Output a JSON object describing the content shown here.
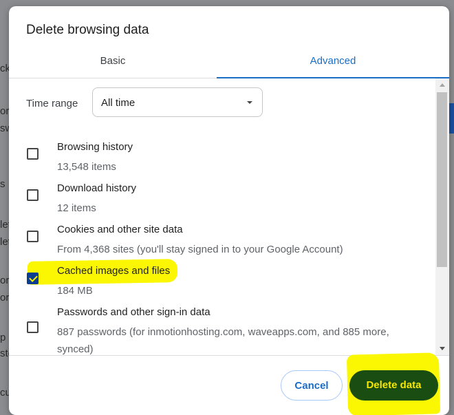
{
  "background": {
    "fragments": [
      "ck",
      "or",
      "sw",
      "s",
      "let",
      "let",
      "ord",
      "ord",
      "p",
      "sto",
      "cu"
    ]
  },
  "dialog": {
    "title": "Delete browsing data",
    "tabs": [
      {
        "label": "Basic",
        "active": false
      },
      {
        "label": "Advanced",
        "active": true
      }
    ],
    "time_range": {
      "label": "Time range",
      "value": "All time"
    },
    "items": [
      {
        "title": "Browsing history",
        "subtitle": "13,548 items",
        "checked": false
      },
      {
        "title": "Download history",
        "subtitle": "12 items",
        "checked": false
      },
      {
        "title": "Cookies and other site data",
        "subtitle": "From 4,368 sites (you'll stay signed in to your Google Account)",
        "checked": false
      },
      {
        "title": "Cached images and files",
        "subtitle": "184 MB",
        "checked": true
      },
      {
        "title": "Passwords and other sign-in data",
        "subtitle": "887 passwords (for inmotionhosting.com, waveapps.com, and 885 more, synced)",
        "checked": false
      }
    ],
    "buttons": {
      "cancel": "Cancel",
      "delete": "Delete data"
    }
  },
  "colors": {
    "accent": "#1a6dc4",
    "highlight": "#fbf703",
    "delete_button_bg": "#1a4d12",
    "delete_button_text": "#f5e700",
    "checkbox_checked": "#0b3d91"
  }
}
